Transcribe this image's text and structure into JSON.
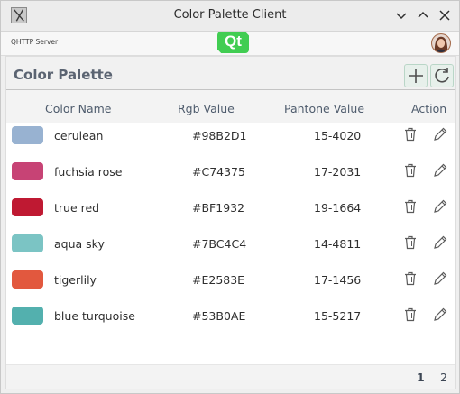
{
  "window": {
    "title": "Color Palette Client"
  },
  "server_bar": {
    "label": "QHTTP Server",
    "logo_text": "Qt"
  },
  "palette": {
    "heading": "Color Palette",
    "columns": {
      "name": "Color Name",
      "rgb": "Rgb Value",
      "pantone": "Pantone Value",
      "action": "Action"
    },
    "rows": [
      {
        "name": "cerulean",
        "rgb": "#98B2D1",
        "pantone": "15-4020",
        "color": "#98B2D1"
      },
      {
        "name": "fuchsia rose",
        "rgb": "#C74375",
        "pantone": "17-2031",
        "color": "#C74375"
      },
      {
        "name": "true red",
        "rgb": "#BF1932",
        "pantone": "19-1664",
        "color": "#BF1932"
      },
      {
        "name": "aqua sky",
        "rgb": "#7BC4C4",
        "pantone": "14-4811",
        "color": "#7BC4C4"
      },
      {
        "name": "tigerlily",
        "rgb": "#E2583E",
        "pantone": "17-1456",
        "color": "#E2583E"
      },
      {
        "name": "blue turquoise",
        "rgb": "#53B0AE",
        "pantone": "15-5217",
        "color": "#53B0AE"
      }
    ],
    "pages": [
      "1",
      "2"
    ],
    "current_page": "1"
  },
  "icons": {
    "add": "plus-icon",
    "refresh": "refresh-icon",
    "delete": "trash-icon",
    "edit": "pencil-icon",
    "minimize": "chevron-down-icon",
    "maximize": "chevron-up-icon",
    "close": "close-icon"
  }
}
